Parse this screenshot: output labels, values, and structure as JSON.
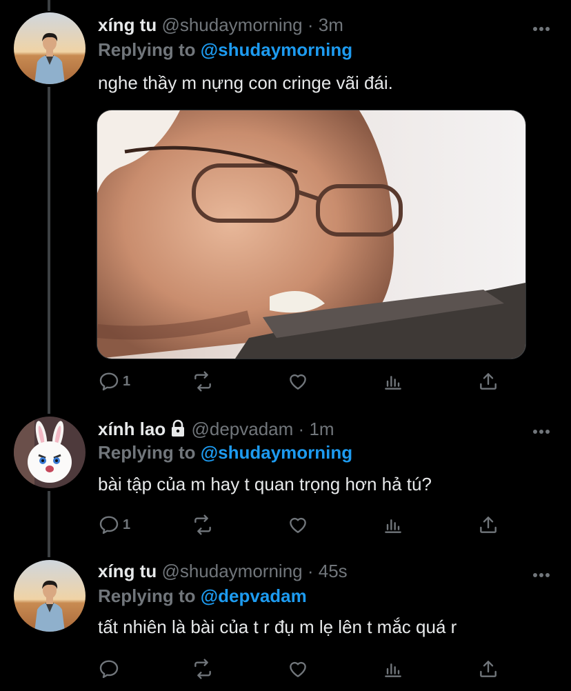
{
  "tweets": [
    {
      "name": "xíng tu",
      "handle": "@shudaymorning",
      "sep": "·",
      "time": "3m",
      "replying_prefix": "Replying to",
      "replying_to": "@shudaymorning",
      "text": "nghe thầy m nựng con cringe vãi đái.",
      "reply_count": "1",
      "avatar_icon": "person-portrait-desert",
      "has_media": true
    },
    {
      "name": "xính lao",
      "handle": "@depvadam",
      "sep": "·",
      "time": "1m",
      "replying_prefix": "Replying to",
      "replying_to": "@shudaymorning",
      "text": "bài tập của m hay t quan trọng hơn hả tú?",
      "reply_count": "1",
      "avatar_icon": "white-bunny",
      "protected_icon": "lock-icon"
    },
    {
      "name": "xíng tu",
      "handle": "@shudaymorning",
      "sep": "·",
      "time": "45s",
      "replying_prefix": "Replying to",
      "replying_to": "@depvadam",
      "text": "tất nhiên là bài của t r đụ m lẹ lên t mắc quá r",
      "reply_count": "",
      "avatar_icon": "person-portrait-desert"
    }
  ],
  "colors": {
    "background": "#000000",
    "text": "#e7e9ea",
    "muted": "#71767b",
    "accent": "#1d9bf0",
    "thread_line": "#3d4144"
  }
}
